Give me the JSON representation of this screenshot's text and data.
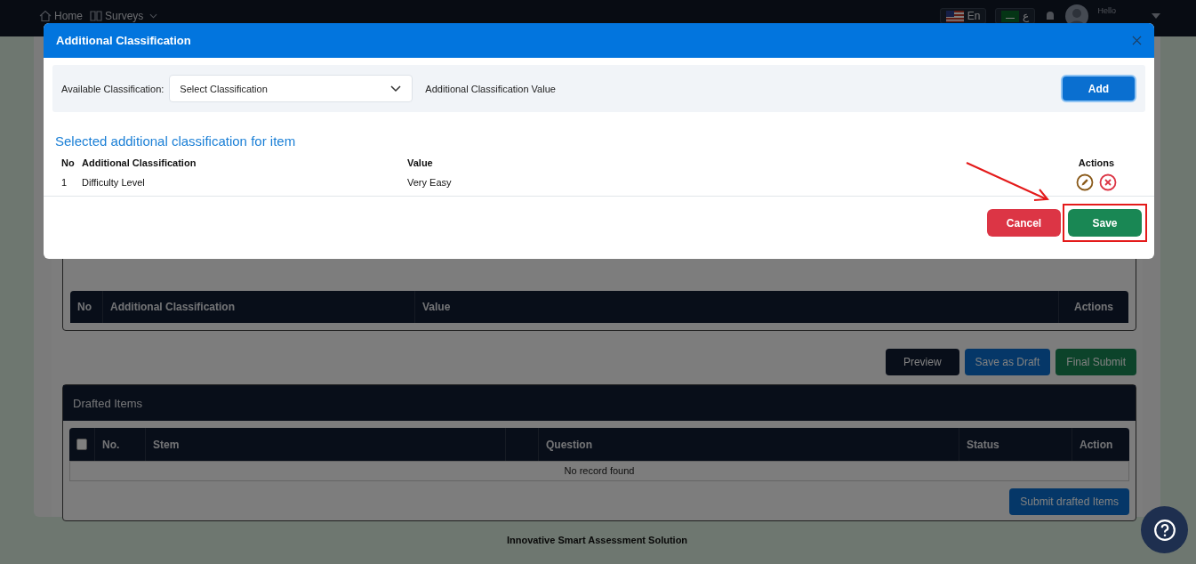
{
  "navbar": {
    "links": [
      {
        "label": "Home",
        "kind": "home"
      },
      {
        "label": "Surveys",
        "kind": "surveys"
      }
    ],
    "languages": [
      {
        "label": "En",
        "kind": "us"
      },
      {
        "label": "ع",
        "kind": "sa"
      }
    ],
    "greeting": "Hello"
  },
  "page": {
    "classification_table": {
      "columns": [
        "No",
        "Additional Classification",
        "Value",
        "Actions"
      ]
    },
    "buttons": [
      {
        "label": "Preview",
        "kind": "dark"
      },
      {
        "label": "Save as Draft",
        "kind": "primary"
      },
      {
        "label": "Final Submit",
        "kind": "success"
      }
    ],
    "drafted": {
      "title": "Drafted Items",
      "select_all": {
        "checked": false
      },
      "columns": [
        "No.",
        "Stem",
        "Question",
        "Status",
        "Action"
      ],
      "empty_message": "No record found",
      "submit": "Submit drafted Items"
    },
    "footer": "Innovative Smart Assessment Solution"
  },
  "modal": {
    "title": "Additional Classification",
    "form": {
      "label": "Available Classification:",
      "select": {
        "placeholder": "Select Classification"
      },
      "value_label": "Additional Classification Value",
      "add": "Add"
    },
    "section_title": "Selected additional classification for item",
    "table": {
      "columns": [
        "No",
        "Additional Classification",
        "Value",
        "Actions"
      ],
      "rows": [
        {
          "no": "1",
          "classification": "Difficulty Level",
          "value": "Very Easy"
        }
      ]
    },
    "buttons": [
      {
        "label": "Cancel",
        "kind": "danger",
        "highlighted": false
      },
      {
        "label": "Save",
        "kind": "success",
        "highlighted": true
      }
    ]
  }
}
